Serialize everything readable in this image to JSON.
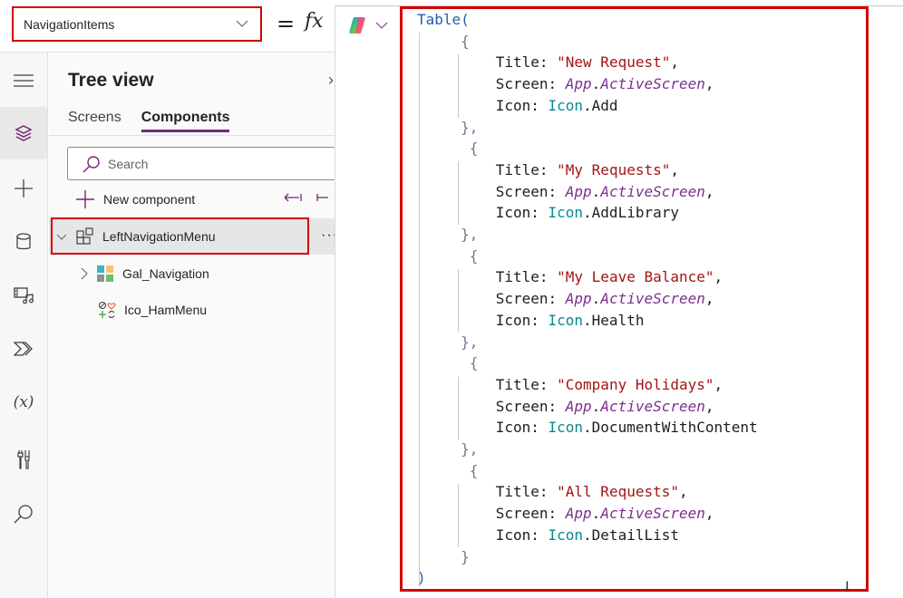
{
  "formula_bar": {
    "property": "NavigationItems",
    "equals": "=",
    "fx": "fx"
  },
  "rail": {
    "items": [
      {
        "name": "hamburger-menu"
      },
      {
        "name": "tree-view",
        "active": true
      },
      {
        "name": "insert"
      },
      {
        "name": "data"
      },
      {
        "name": "media"
      },
      {
        "name": "power-automate"
      },
      {
        "name": "variables"
      },
      {
        "name": "advanced-tools"
      },
      {
        "name": "search"
      }
    ]
  },
  "tree": {
    "title": "Tree view",
    "tabs": [
      {
        "label": "Screens",
        "active": false
      },
      {
        "label": "Components",
        "active": true
      }
    ],
    "search_placeholder": "Search",
    "new_component": "New component",
    "items": [
      {
        "label": "LeftNavigationMenu",
        "level": 0,
        "expanded": true,
        "selected": true,
        "icon": "component-icon"
      },
      {
        "label": "Gal_Navigation",
        "level": 1,
        "expanded": false,
        "icon": "gallery-icon"
      },
      {
        "label": "Ico_HamMenu",
        "level": 1,
        "icon": "icons-control-icon"
      }
    ],
    "more": "···"
  },
  "editor": {
    "colors": {
      "function": "#1f5fae",
      "string": "#a31515",
      "app": "#7b2f8e",
      "icon": "#098a8f",
      "highlight": "#d40000"
    },
    "open": "Table(",
    "close": ")",
    "records": [
      {
        "title": "\"New Request\"",
        "screen_obj": "App",
        "screen_prop": "ActiveScreen",
        "icon_obj": "Icon",
        "icon_prop": "Add"
      },
      {
        "title": "\"My Requests\"",
        "screen_obj": "App",
        "screen_prop": "ActiveScreen",
        "icon_obj": "Icon",
        "icon_prop": "AddLibrary"
      },
      {
        "title": "\"My Leave Balance\"",
        "screen_obj": "App",
        "screen_prop": "ActiveScreen",
        "icon_obj": "Icon",
        "icon_prop": "Health"
      },
      {
        "title": "\"Company Holidays\"",
        "screen_obj": "App",
        "screen_prop": "ActiveScreen",
        "icon_obj": "Icon",
        "icon_prop": "DocumentWithContent"
      },
      {
        "title": "\"All Requests\"",
        "screen_obj": "App",
        "screen_prop": "ActiveScreen",
        "icon_obj": "Icon",
        "icon_prop": "DetailList"
      }
    ],
    "keys": {
      "title": "Title: ",
      "screen": "Screen: ",
      "icon": "Icon: "
    }
  }
}
